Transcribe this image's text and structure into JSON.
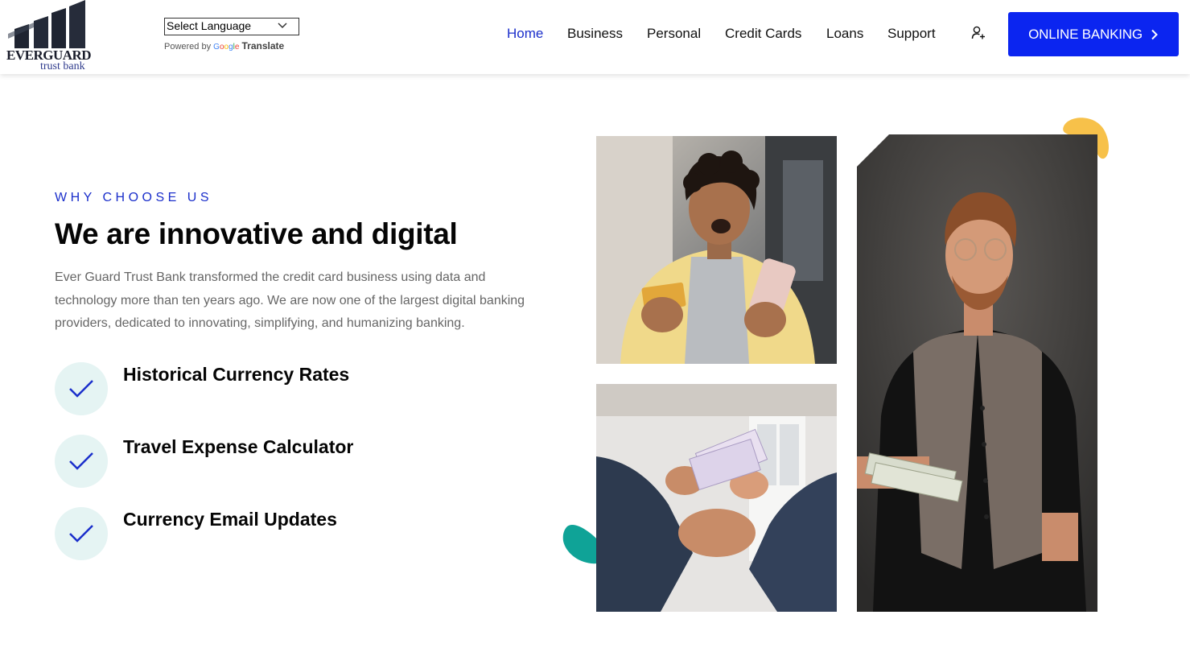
{
  "header": {
    "logo": {
      "word": "EVERGUARD",
      "sub": "trust bank"
    },
    "translate": {
      "select_label": "Select Language",
      "powered_by": "Powered by",
      "google": "Google",
      "translate": "Translate"
    },
    "nav": [
      {
        "label": "Home",
        "active": true
      },
      {
        "label": "Business",
        "active": false
      },
      {
        "label": "Personal",
        "active": false
      },
      {
        "label": "Credit Cards",
        "active": false
      },
      {
        "label": "Loans",
        "active": false
      },
      {
        "label": "Support",
        "active": false
      }
    ],
    "account_icon": "user-plus-icon",
    "cta": {
      "label": "ONLINE BANKING",
      "icon": "chevron-right-icon"
    }
  },
  "hero": {
    "eyebrow": "WHY CHOOSE US",
    "headline": "We are innovative and digital",
    "description": "Ever Guard Trust Bank transformed the credit card business using data and technology more than ten years ago. We are now one of the largest digital banking providers, dedicated to innovating, simplifying, and humanizing banking.",
    "features": [
      {
        "label": "Historical Currency Rates",
        "icon": "check-icon"
      },
      {
        "label": "Travel Expense Calculator",
        "icon": "check-icon"
      },
      {
        "label": "Currency Email Updates",
        "icon": "check-icon"
      }
    ]
  },
  "colors": {
    "brand_blue": "#1b2fcb",
    "button_blue": "#0b25f0",
    "check_bg": "#e5f4f3",
    "accent_yellow": "#f7c14a",
    "accent_teal": "#0fa397"
  }
}
